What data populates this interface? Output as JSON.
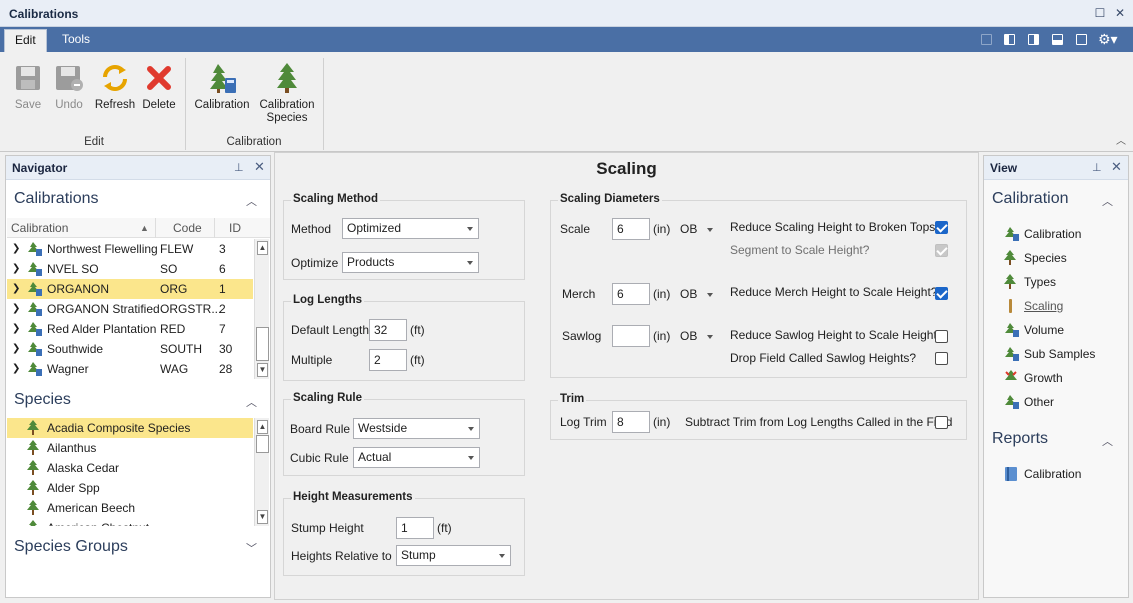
{
  "window": {
    "title": "Calibrations"
  },
  "ribbon": {
    "tabs": [
      {
        "label": "Edit"
      },
      {
        "label": "Tools"
      }
    ],
    "buttons": {
      "save": "Save",
      "undo": "Undo",
      "refresh": "Refresh",
      "delete": "Delete",
      "calibration": "Calibration",
      "species_l1": "Calibration",
      "species_l2": "Species"
    },
    "groups": {
      "edit": "Edit",
      "calibration": "Calibration"
    }
  },
  "navigator": {
    "title": "Navigator",
    "calibrations_header": "Calibrations",
    "columns": {
      "calibration": "Calibration",
      "code": "Code",
      "id": "ID"
    },
    "rows": [
      {
        "name": "Northwest Flewelling",
        "code": "FLEW",
        "id": "3"
      },
      {
        "name": "NVEL SO",
        "code": "SO",
        "id": "6"
      },
      {
        "name": "ORGANON",
        "code": "ORG",
        "id": "1"
      },
      {
        "name": "ORGANON Stratified",
        "code": "ORGSTR...",
        "id": "2"
      },
      {
        "name": "Red Alder Plantation",
        "code": "RED",
        "id": "7"
      },
      {
        "name": "Southwide",
        "code": "SOUTH",
        "id": "30"
      },
      {
        "name": "Wagner",
        "code": "WAG",
        "id": "28"
      }
    ],
    "species_header": "Species",
    "species": [
      "Acadia Composite Species",
      "Ailanthus",
      "Alaska Cedar",
      "Alder Spp",
      "American Beech",
      "American Chestnut"
    ],
    "species_groups_header": "Species Groups"
  },
  "main": {
    "title": "Scaling",
    "scaling_method": {
      "legend": "Scaling Method",
      "method_label": "Method",
      "method_value": "Optimized",
      "optimize_label": "Optimize",
      "optimize_value": "Products"
    },
    "log_lengths": {
      "legend": "Log Lengths",
      "default_label": "Default Length",
      "default_value": "32",
      "default_unit": "(ft)",
      "multiple_label": "Multiple",
      "multiple_value": "2",
      "multiple_unit": "(ft)"
    },
    "scaling_rule": {
      "legend": "Scaling Rule",
      "board_label": "Board Rule",
      "board_value": "Westside",
      "cubic_label": "Cubic Rule",
      "cubic_value": "Actual"
    },
    "height": {
      "legend": "Height Measurements",
      "stump_label": "Stump Height",
      "stump_value": "1",
      "stump_unit": "(ft)",
      "relative_label": "Heights Relative to",
      "relative_value": "Stump"
    },
    "diameters": {
      "legend": "Scaling Diameters",
      "scale_label": "Scale",
      "scale_value": "6",
      "scale_unit": "(in)",
      "scale_ob": "OB",
      "scale_q1": "Reduce Scaling Height to Broken Tops?",
      "scale_q1_checked": true,
      "scale_q2": "Segment to Scale Height?",
      "scale_q2_checked": true,
      "merch_label": "Merch",
      "merch_value": "6",
      "merch_unit": "(in)",
      "merch_ob": "OB",
      "merch_q": "Reduce Merch Height to Scale Height?",
      "merch_q_checked": true,
      "sawlog_label": "Sawlog",
      "sawlog_value": "",
      "sawlog_unit": "(in)",
      "sawlog_ob": "OB",
      "sawlog_q1": "Reduce Sawlog Height to Scale Height?",
      "sawlog_q1_checked": false,
      "sawlog_q2": "Drop Field Called Sawlog Heights?",
      "sawlog_q2_checked": false
    },
    "trim": {
      "legend": "Trim",
      "label": "Log Trim",
      "value": "8",
      "unit": "(in)",
      "question": "Subtract Trim from Log Lengths Called in the Field",
      "checked": false
    }
  },
  "view": {
    "title": "View",
    "calibration_header": "Calibration",
    "items": [
      "Calibration",
      "Species",
      "Types",
      "Scaling",
      "Volume",
      "Sub Samples",
      "Growth",
      "Other"
    ],
    "reports_header": "Reports",
    "reports": [
      "Calibration"
    ]
  },
  "colors": {
    "accent": "#4a6fa5",
    "selection": "#fbe68c",
    "check": "#1b66c9",
    "tree": "#4f8a3a"
  }
}
